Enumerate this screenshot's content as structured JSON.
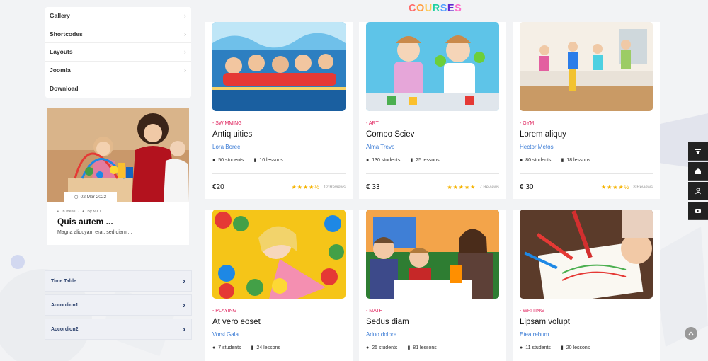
{
  "menu": {
    "items": [
      {
        "label": "Gallery"
      },
      {
        "label": "Shortcodes"
      },
      {
        "label": "Layouts"
      },
      {
        "label": "Joomla"
      },
      {
        "label": "Download"
      }
    ]
  },
  "blog": {
    "date": "02 Mar 2022",
    "category": "In Ideas",
    "author": "By MXT",
    "title": "Quis autem ...",
    "excerpt": "Magna aliquyam erat, sed diam ..."
  },
  "accordion": {
    "items": [
      {
        "label": "Time Table"
      },
      {
        "label": "Accordion1"
      },
      {
        "label": "Accordion2"
      }
    ]
  },
  "courses": {
    "title": "COURSES",
    "title_colors": [
      "#ff6b6b",
      "#ff9f43",
      "#feca57",
      "#1dd1a1",
      "#54a0ff",
      "#5f27cd",
      "#ff6bcb"
    ],
    "items": [
      {
        "category": "- SWIMMING",
        "title": "Antiq uities",
        "teacher": "Lora Borec",
        "students": "50 students",
        "lessons": "10 lessons",
        "price": "€20",
        "rating": 4.5,
        "reviews": "12 Reviews",
        "image": "children-swimming-pool"
      },
      {
        "category": "- ART",
        "title": "Compo Sciev",
        "teacher": "Alma Trevo",
        "students": "130 students",
        "lessons": "25 lessons",
        "price": "€ 33",
        "rating": 5,
        "reviews": "7 Reviews",
        "image": "girls-painting"
      },
      {
        "category": "- GYM",
        "title": "Lorem aliquy",
        "teacher": "Hector Metos",
        "students": "80 students",
        "lessons": "18 lessons",
        "price": "€ 30",
        "rating": 4.5,
        "reviews": "8 Reviews",
        "image": "kids-dancing"
      },
      {
        "category": "- PLAYING",
        "title": "At vero eoset",
        "teacher": "Vorsl Gala",
        "students": "7 students",
        "lessons": "24 lessons",
        "image": "girl-ball-pit"
      },
      {
        "category": "- MATH",
        "title": "Sedus diam",
        "teacher": "Aduo dolore",
        "students": "25 students",
        "lessons": "81 lessons",
        "image": "teacher-with-kids"
      },
      {
        "category": "- WRITING",
        "title": "Lipsam volupt",
        "teacher": "Etea rebum",
        "students": "11 students",
        "lessons": "20 lessons",
        "image": "child-drawing"
      }
    ]
  },
  "side_tools": [
    "layout-icon",
    "inbox-icon",
    "user-icon",
    "video-icon"
  ]
}
